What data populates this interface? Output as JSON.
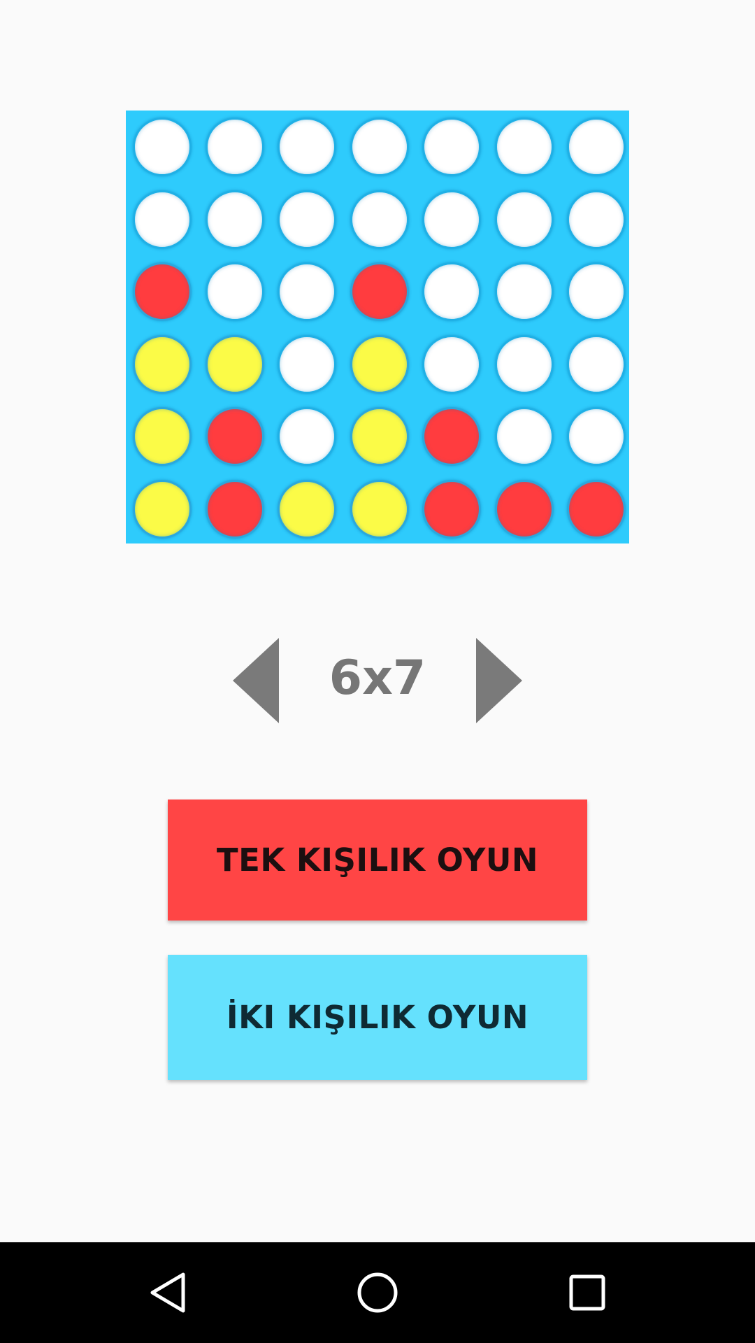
{
  "board": {
    "rows": 6,
    "cols": 7,
    "frame_color": "#2ecbfc",
    "piece_colors": {
      "white": "#ffffff",
      "red": "#ff3c3f",
      "yellow": "#fbfb47"
    },
    "cells": [
      [
        "white",
        "white",
        "white",
        "white",
        "white",
        "white",
        "white"
      ],
      [
        "white",
        "white",
        "white",
        "white",
        "white",
        "white",
        "white"
      ],
      [
        "red",
        "white",
        "white",
        "red",
        "white",
        "white",
        "white"
      ],
      [
        "yellow",
        "yellow",
        "white",
        "yellow",
        "white",
        "white",
        "white"
      ],
      [
        "yellow",
        "red",
        "white",
        "yellow",
        "red",
        "white",
        "white"
      ],
      [
        "yellow",
        "red",
        "yellow",
        "yellow",
        "red",
        "red",
        "red"
      ]
    ]
  },
  "size_selector": {
    "value": "6x7",
    "prev_icon": "triangle-left-icon",
    "next_icon": "triangle-right-icon"
  },
  "buttons": {
    "single_player": "TEK KIŞILIK OYUN",
    "two_player": "İKI KIŞILIK OYUN"
  },
  "nav": {
    "back_icon": "back-icon",
    "home_icon": "home-icon",
    "recents_icon": "recents-icon"
  }
}
